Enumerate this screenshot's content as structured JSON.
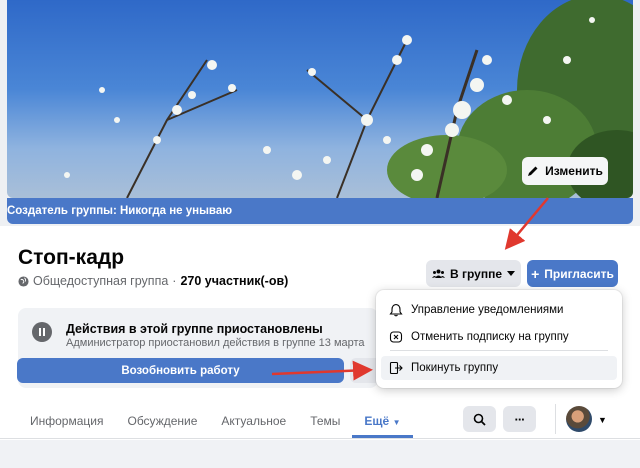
{
  "cover": {
    "creator_text": "Создатель группы: Никогда не унываю",
    "edit_label": "Изменить"
  },
  "group": {
    "name": "Стоп-кадр",
    "privacy": "Общедоступная группа",
    "separator": "·",
    "members": "270 участник(-ов)"
  },
  "actions": {
    "in_group_label": "В группе",
    "invite_label": "Пригласить"
  },
  "paused": {
    "title": "Действия в этой группе приостановлены",
    "description": "Администратор приостановил действия в группе 13 марта",
    "resume_label": "Возобновить работу"
  },
  "tabs": [
    {
      "label": "Информация"
    },
    {
      "label": "Обсуждение"
    },
    {
      "label": "Актуальное"
    },
    {
      "label": "Темы"
    },
    {
      "label": "Ещё"
    }
  ],
  "toolbar": {
    "search_icon": "search-icon",
    "more_label": "···"
  },
  "dropdown": {
    "items": [
      {
        "label": "Управление уведомлениями",
        "icon": "bell-icon"
      },
      {
        "label": "Отменить подписку на группу",
        "icon": "unfollow-icon"
      },
      {
        "label": "Покинуть группу",
        "icon": "leave-icon"
      }
    ]
  },
  "colors": {
    "accent": "#4a78c8",
    "arrow": "#e0382e"
  }
}
